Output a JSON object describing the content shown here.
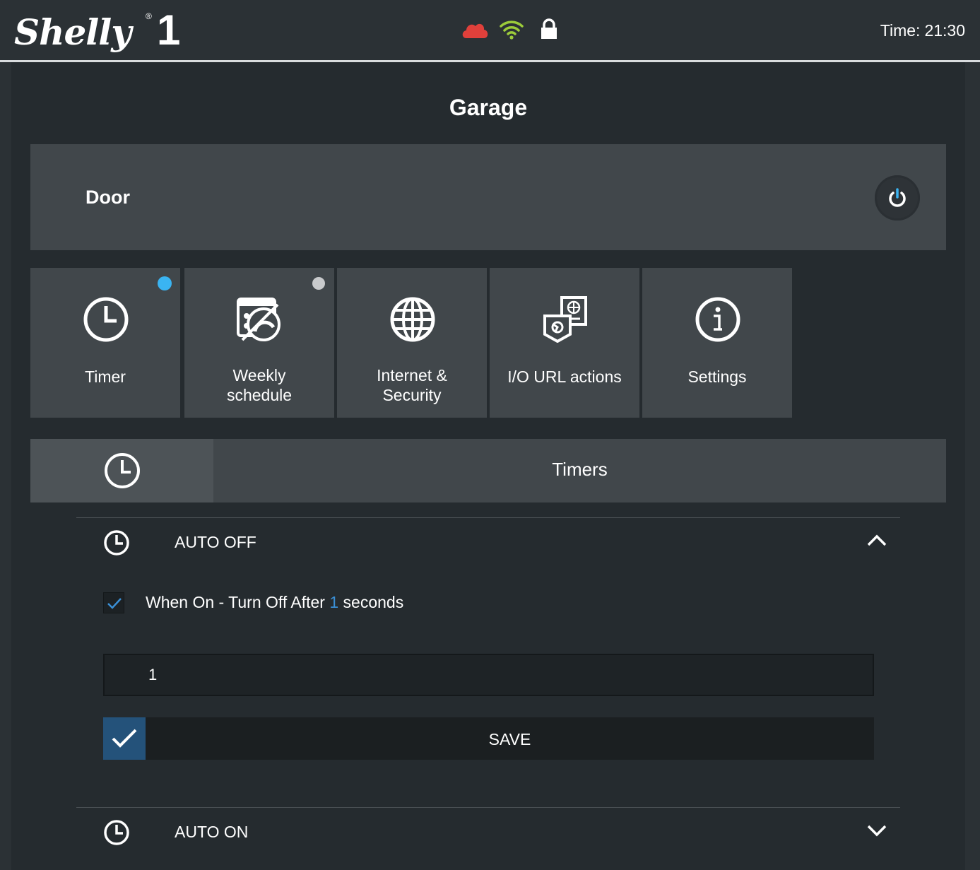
{
  "app": {
    "brand": "Shelly",
    "model": "1",
    "registered": "®"
  },
  "header": {
    "time_label": "Time:",
    "time_value": "21:30",
    "cloud_color": "#e0403b",
    "wifi_color": "#9ccc3a"
  },
  "device": {
    "group_title": "Garage",
    "channel_name": "Door",
    "power_icon_color": "#3ab4f2"
  },
  "tiles": [
    {
      "label": "Timer",
      "icon": "clock-icon",
      "indicator": "active",
      "indicator_color": "#3ab4f2"
    },
    {
      "label_line1": "Weekly",
      "label_line2": "schedule",
      "icon": "weekly-schedule-icon",
      "indicator": "inactive",
      "indicator_color": "#c8cacc"
    },
    {
      "label_line1": "Internet &",
      "label_line2": "Security",
      "icon": "globe-icon"
    },
    {
      "label": "I/O URL actions",
      "icon": "io-url-icon"
    },
    {
      "label": "Settings",
      "icon": "info-icon"
    }
  ],
  "section": {
    "title": "Timers",
    "icon": "clock-icon"
  },
  "auto_off": {
    "title": "AUTO OFF",
    "expanded": true,
    "checkbox_checked": true,
    "text_before": "When On - Turn Off After",
    "value": "1",
    "text_after": "seconds",
    "input_value": "1",
    "save_label": "SAVE"
  },
  "auto_on": {
    "title": "AUTO ON",
    "expanded": false
  }
}
